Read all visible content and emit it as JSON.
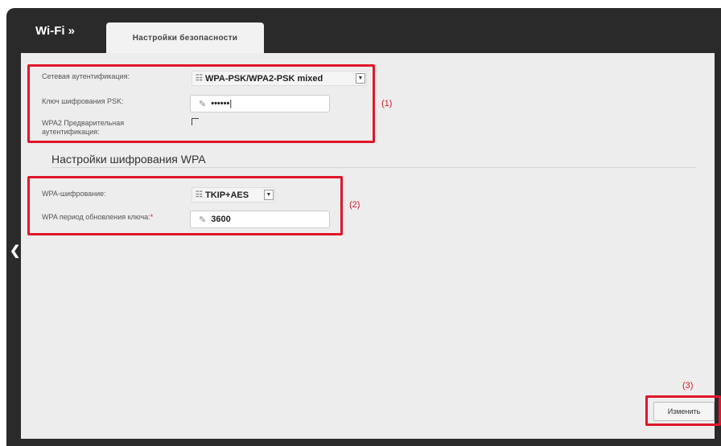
{
  "breadcrumb": "Wi-Fi »",
  "tab_label": "Настройки безопасности",
  "auth": {
    "network_auth_label": "Сетевая аутентификация:",
    "network_auth_value": "WPA-PSK/WPA2-PSK mixed",
    "psk_label": "Ключ шифрования PSK:",
    "psk_value": "••••••",
    "wpa2_preauth_label_line1": "WPA2 Предварительная",
    "wpa2_preauth_label_line2": "аутентификация:",
    "wpa2_preauth_checked": false
  },
  "wpa_section_title": "Настройки шифрования WPA",
  "wpa": {
    "encryption_label": "WPA-шифрование:",
    "encryption_value": "TKIP+AES",
    "rekey_label": "WPA период обновления ключа:",
    "rekey_required_mark": "*",
    "rekey_value": "3600"
  },
  "annotations": {
    "a1": "(1)",
    "a2": "(2)",
    "a3": "(3)"
  },
  "change_button_label": "Изменить",
  "colors": {
    "highlight_red": "#e0162b",
    "shell_dark": "#2a2a2a",
    "content_bg": "#ededed"
  },
  "icons": {
    "back": "chevron-left-icon",
    "select_grip": "grip-icon",
    "dropdown": "chevron-down-icon",
    "edit": "pencil-icon"
  }
}
